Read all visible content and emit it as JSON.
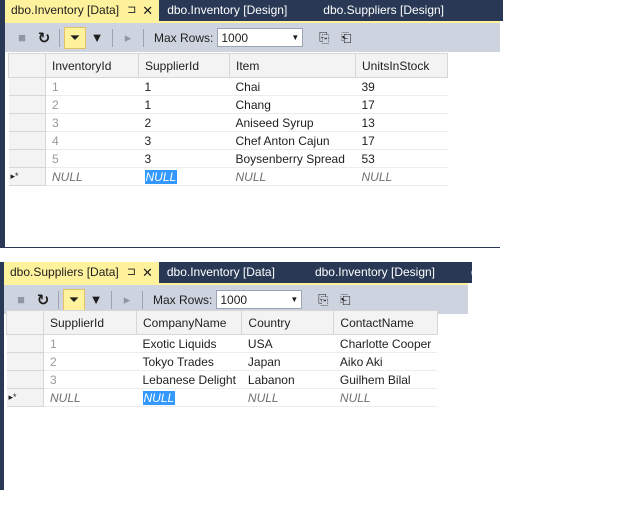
{
  "top": {
    "tabs": [
      {
        "label": "dbo.Inventory [Data]",
        "pin": "⊐",
        "close": "✕"
      },
      {
        "label": "dbo.Inventory [Design]"
      },
      {
        "label": "dbo.Suppliers [Design]"
      }
    ],
    "toolbar": {
      "max_rows_label": "Max Rows:",
      "max_rows_value": "1000"
    },
    "columns": [
      "InventoryId",
      "SupplierId",
      "Item",
      "UnitsInStock"
    ],
    "rows": [
      [
        "1",
        "1",
        "Chai",
        "39"
      ],
      [
        "2",
        "1",
        "Chang",
        "17"
      ],
      [
        "3",
        "2",
        "Aniseed Syrup",
        "13"
      ],
      [
        "4",
        "3",
        "Chef Anton Cajun",
        "17"
      ],
      [
        "5",
        "3",
        "Boysenberry Spread",
        "53"
      ]
    ],
    "new_row": {
      "marker": "▸*",
      "values": [
        "NULL",
        "NULL",
        "NULL",
        "NULL"
      ]
    }
  },
  "bottom": {
    "tabs": [
      {
        "label": "dbo.Suppliers [Data]",
        "pin": "⊐",
        "close": "✕"
      },
      {
        "label": "dbo.Inventory [Data]"
      },
      {
        "label": "dbo.Inventory [Design]"
      },
      {
        "label": "dbo."
      }
    ],
    "toolbar": {
      "max_rows_label": "Max Rows:",
      "max_rows_value": "1000"
    },
    "columns": [
      "SupplierId",
      "CompanyName",
      "Country",
      "ContactName"
    ],
    "rows": [
      [
        "1",
        "Exotic Liquids",
        "USA",
        "Charlotte Cooper"
      ],
      [
        "2",
        "Tokyo Trades",
        "Japan",
        "Aiko Aki"
      ],
      [
        "3",
        "Lebanese Delight",
        "Labanon",
        "Guilhem Bilal"
      ]
    ],
    "new_row": {
      "marker": "▸*",
      "values": [
        "NULL",
        "NULL",
        "NULL",
        "NULL"
      ]
    }
  }
}
